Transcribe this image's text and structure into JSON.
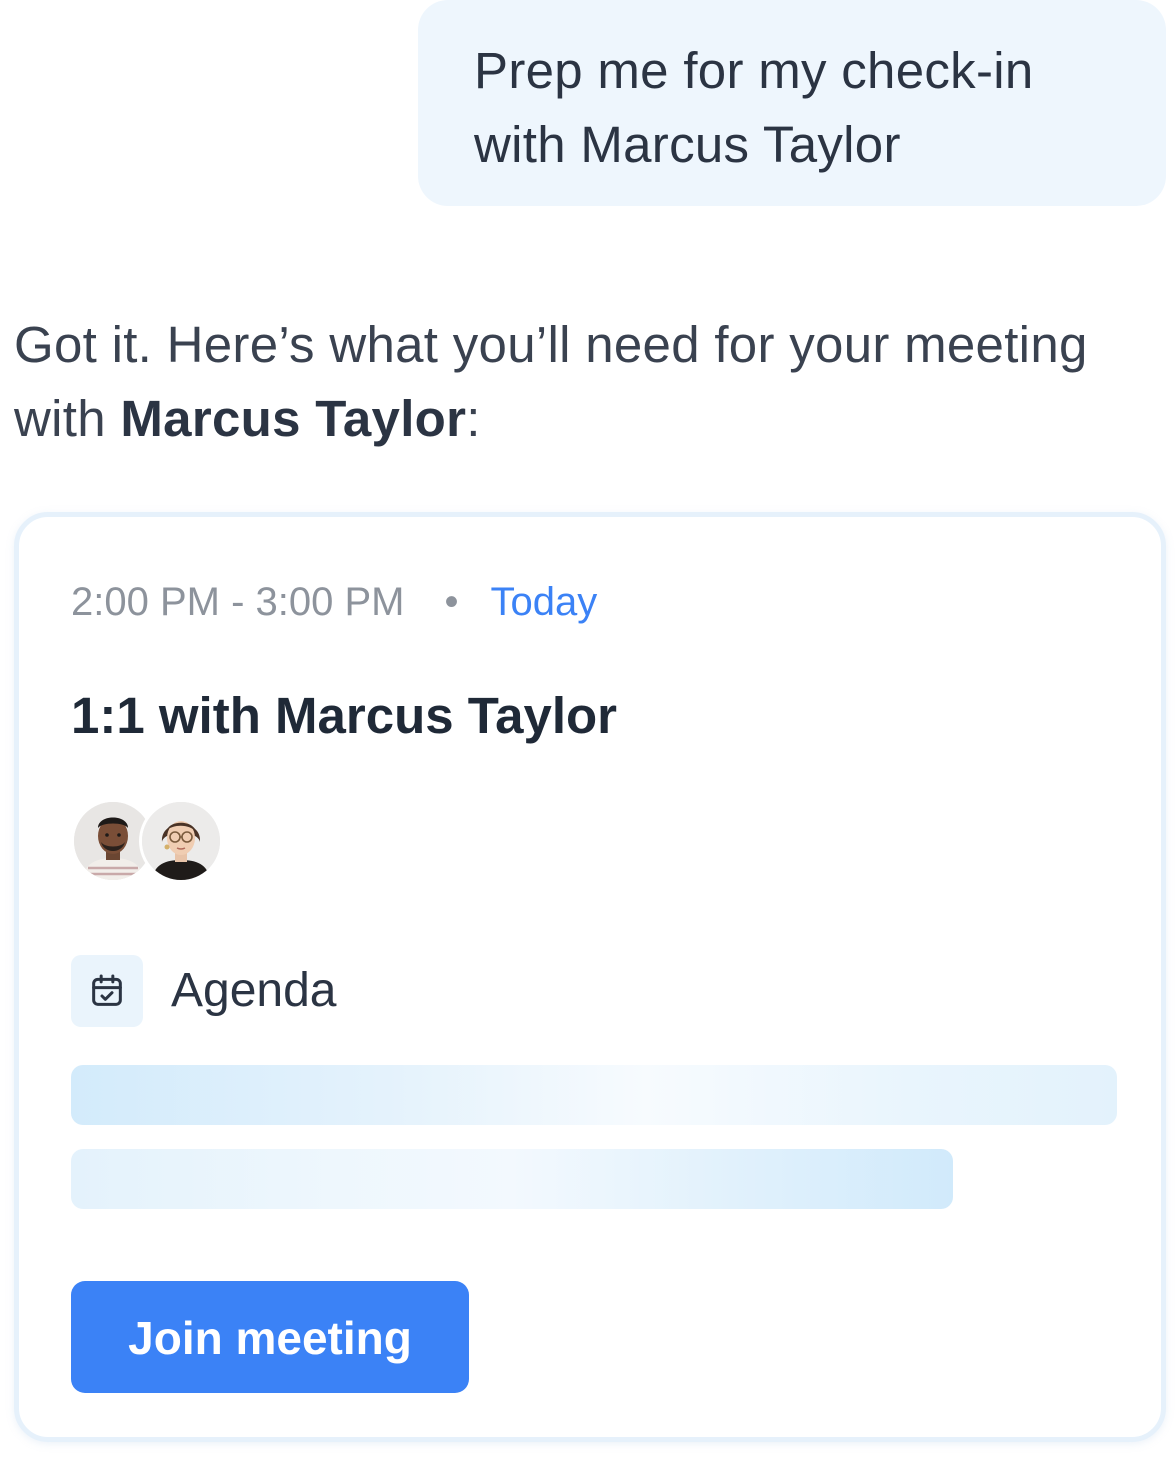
{
  "user_message": {
    "text": "Prep me for my check-in with Marcus Taylor"
  },
  "assistant_message": {
    "prefix": "Got it. Here’s what you’ll need for your meeting with ",
    "name": "Marcus Taylor",
    "suffix": ":"
  },
  "meeting_card": {
    "time": "2:00 PM - 3:00 PM",
    "separator": "•",
    "day": "Today",
    "title": "1:1 with Marcus Taylor",
    "attendees": [
      "attendee-avatar-man",
      "attendee-avatar-woman"
    ],
    "agenda_label": "Agenda",
    "agenda_icon": "calendar-check-icon",
    "join_label": "Join meeting"
  },
  "colors": {
    "accent": "#3b82f6",
    "bubble_bg": "#eef6fd",
    "muted_text": "#8d939c"
  }
}
